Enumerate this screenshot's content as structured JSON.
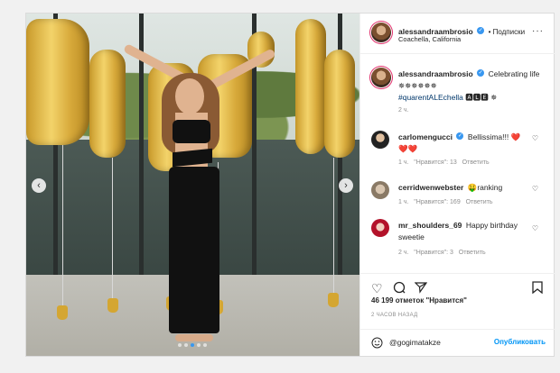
{
  "post": {
    "username": "alessandraambrosio",
    "follow_label": "• Подписки",
    "location": "Coachella, California",
    "more_label": "···"
  },
  "caption": {
    "username": "alessandraambrosio",
    "text": "Celebrating life ✵✵✵✵✵✵",
    "hashtag": "#quarentALEchella",
    "hashtag_suffix": " 🅰🅻🅴 ✵",
    "time": "2 ч."
  },
  "comments": [
    {
      "username": "carlomengucci",
      "verified": true,
      "text": "Bellissima!!! ❤️",
      "extra": "❤️❤️",
      "time": "1 ч.",
      "likes": "\"Нравится\": 13",
      "reply": "Ответить"
    },
    {
      "username": "cerridwenwebster",
      "verified": false,
      "text": "🤑ranking",
      "extra": "",
      "time": "1 ч.",
      "likes": "\"Нравится\": 169",
      "reply": "Ответить"
    },
    {
      "username": "mr_shoulders_69",
      "verified": false,
      "text": "Happy birthday sweetie",
      "extra": "",
      "time": "2 ч.",
      "likes": "\"Нравится\": 3",
      "reply": "Ответить"
    }
  ],
  "actions": {
    "like_icon": "heart-outline",
    "comment_icon": "speech-bubble",
    "share_icon": "paper-plane",
    "save_icon": "bookmark"
  },
  "likes_text": "46 199 отметок \"Нравится\"",
  "time_ago": "2 ЧАСОВ НАЗАД",
  "comment_input": {
    "emoji_icon": "smiley",
    "placeholder": "@gogimatakze",
    "post_label": "Опубликовать"
  },
  "colors": {
    "accent": "#3897f0",
    "heart": "#ed4956"
  }
}
